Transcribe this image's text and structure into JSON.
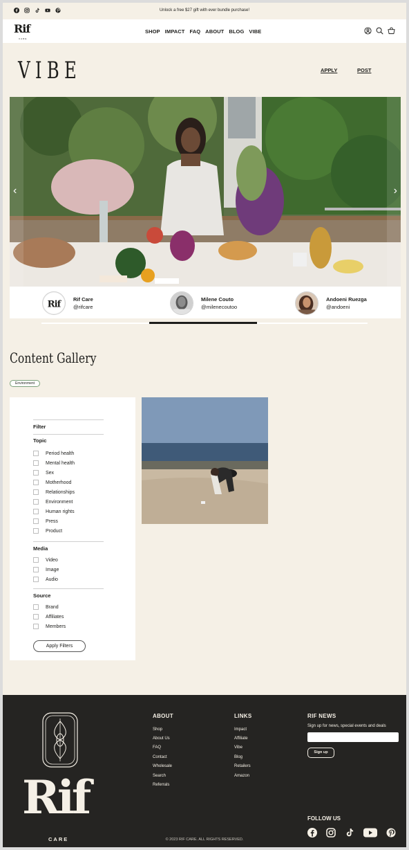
{
  "announcement": {
    "text": "Unlock a free $27 gift with ever bundle purchase!",
    "social_icons": [
      "facebook-icon",
      "instagram-icon",
      "tiktok-icon",
      "youtube-icon",
      "pinterest-icon"
    ]
  },
  "header": {
    "logo": "Rif",
    "logo_sub": "CARE",
    "nav": [
      "SHOP",
      "IMPACT",
      "FAQ",
      "ABOUT",
      "BLOG",
      "VIBE"
    ],
    "icons": [
      "account-icon",
      "search-icon",
      "cart-icon"
    ]
  },
  "vibe": {
    "title": "VIBE",
    "apply_label": "APPLY",
    "post_label": "POST"
  },
  "carousel": {
    "creators": [
      {
        "name": "Rif Care",
        "handle": "@rifcare"
      },
      {
        "name": "Milene Couto",
        "handle": "@milenecoutoo"
      },
      {
        "name": "Andoeni Ruezga",
        "handle": "@andoeni"
      }
    ],
    "progress_fraction": 0.33
  },
  "gallery": {
    "title": "Content Gallery",
    "active_tag": "Environment",
    "filter": {
      "title": "Filter",
      "topic_title": "Topic",
      "topics": [
        "Period health",
        "Mental health",
        "Sex",
        "Motherhood",
        "Relationships",
        "Environment",
        "Human rights",
        "Press",
        "Product"
      ],
      "media_title": "Media",
      "media": [
        "Video",
        "Image",
        "Audio"
      ],
      "source_title": "Source",
      "sources": [
        "Brand",
        "Affiliates",
        "Members"
      ],
      "apply_label": "Apply Filters"
    }
  },
  "footer": {
    "logo": "Rif",
    "logo_sub": "CARE",
    "about_title": "ABOUT",
    "about_links": [
      "Shop",
      "About Us",
      "FAQ",
      "Contact",
      "Wholesale",
      "Search",
      "Referrals"
    ],
    "links_title": "LINKS",
    "links": [
      "Impact",
      "Affiliate",
      "Vibe",
      "Blog",
      "Retailers",
      "Amazon"
    ],
    "news_title": "RIF NEWS",
    "news_text": "Sign up for news, special events and deals",
    "signup_label": "Sign up",
    "follow_title": "FOLLOW US",
    "copyright": "© 2023 RIF CARE. ALL RIGHTS RESERVED."
  },
  "colors": {
    "background": "#f5f0e6",
    "footer": "#252422",
    "text": "#1d1d1b"
  }
}
